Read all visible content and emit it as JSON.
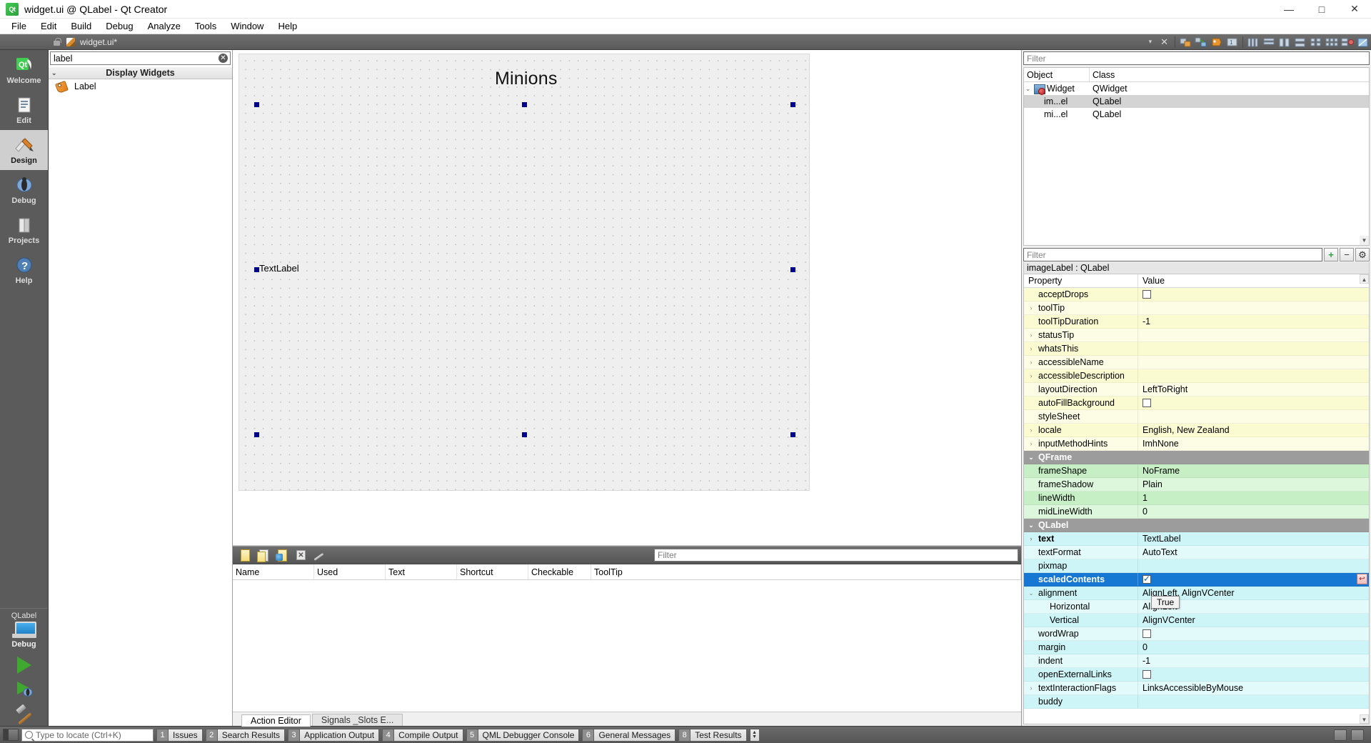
{
  "window": {
    "title": "widget.ui @ QLabel - Qt Creator",
    "app_icon": "qt-logo-icon",
    "minimize": "—",
    "maximize": "□",
    "close": "✕"
  },
  "menubar": [
    {
      "label": "File"
    },
    {
      "label": "Edit"
    },
    {
      "label": "Build"
    },
    {
      "label": "Debug"
    },
    {
      "label": "Analyze"
    },
    {
      "label": "Tools"
    },
    {
      "label": "Window"
    },
    {
      "label": "Help"
    }
  ],
  "toolrow": {
    "file_tab": "widget.ui*",
    "dropdown_arrow": "▾",
    "close_x": "✕"
  },
  "modes": [
    {
      "label": "Welcome",
      "icon": "qt-logo-icon",
      "active": false
    },
    {
      "label": "Edit",
      "icon": "document-lines-icon",
      "active": false
    },
    {
      "label": "Design",
      "icon": "brush-ruler-icon",
      "active": true
    },
    {
      "label": "Debug",
      "icon": "bug-icon",
      "active": false
    },
    {
      "label": "Projects",
      "icon": "books-icon",
      "active": false
    },
    {
      "label": "Help",
      "icon": "question-circle-icon",
      "active": false
    }
  ],
  "kit_selector": {
    "kit_name": "QLabel",
    "build_config": "Debug",
    "monitor_icon": "computer-monitor-icon",
    "expand_arrow": "▸"
  },
  "run_buttons": [
    {
      "name": "run",
      "icon": "green-play-triangle-icon"
    },
    {
      "name": "debug",
      "icon": "play-with-bug-icon"
    },
    {
      "name": "build",
      "icon": "hammer-icon"
    }
  ],
  "widget_box": {
    "filter_value": "label",
    "filter_placeholder": "Filter",
    "clear_icon": "✕",
    "group": {
      "label": "Display Widgets",
      "arrow": "⌄"
    },
    "items": [
      {
        "label": "Label",
        "icon": "label-tag-icon"
      }
    ]
  },
  "canvas": {
    "form_title": "Minions",
    "text_label": "TextLabel",
    "handles": 8
  },
  "action_editor": {
    "toolbar_icons": [
      "new-action-icon",
      "copy-action-icon",
      "edit-action-icon",
      "delete-action-icon",
      "configure-icon"
    ],
    "filter_placeholder": "Filter",
    "columns": [
      "Name",
      "Used",
      "Text",
      "Shortcut",
      "Checkable",
      "ToolTip"
    ],
    "rows": [],
    "tabs": [
      {
        "label": "Action Editor",
        "active": true
      },
      {
        "label": "Signals _Slots E...",
        "active": false
      }
    ]
  },
  "object_inspector": {
    "filter_placeholder": "Filter",
    "columns": [
      "Object",
      "Class"
    ],
    "rows": [
      {
        "object": "Widget",
        "class": "QWidget",
        "depth": 0,
        "expand": "⌄",
        "icon": "widget-icon",
        "selected": false
      },
      {
        "object": "im...el",
        "class": "QLabel",
        "depth": 1,
        "expand": "",
        "icon": "",
        "selected": true
      },
      {
        "object": "mi...el",
        "class": "QLabel",
        "depth": 1,
        "expand": "",
        "icon": "",
        "selected": false
      }
    ]
  },
  "property_editor": {
    "filter_placeholder": "Filter",
    "add_button": "+",
    "remove_button": "−",
    "config_button": "⚙",
    "object_label": "imageLabel : QLabel",
    "columns": [
      "Property",
      "Value"
    ],
    "tooltip": "True",
    "scroll_up": "▲",
    "scroll_down": "▼",
    "reset_icon": "↩",
    "rows": [
      {
        "name": "acceptDrops",
        "value": "",
        "type": "checkbox",
        "checked": false,
        "group": "qwidget",
        "expand": false,
        "indent": 1
      },
      {
        "name": "toolTip",
        "value": "",
        "type": "text",
        "group": "qwidget",
        "expand": true,
        "indent": 0
      },
      {
        "name": "toolTipDuration",
        "value": "-1",
        "type": "text",
        "group": "qwidget",
        "expand": false,
        "indent": 1
      },
      {
        "name": "statusTip",
        "value": "",
        "type": "text",
        "group": "qwidget",
        "expand": true,
        "indent": 0
      },
      {
        "name": "whatsThis",
        "value": "",
        "type": "text",
        "group": "qwidget",
        "expand": true,
        "indent": 0
      },
      {
        "name": "accessibleName",
        "value": "",
        "type": "text",
        "group": "qwidget",
        "expand": true,
        "indent": 0
      },
      {
        "name": "accessibleDescription",
        "value": "",
        "type": "text",
        "group": "qwidget",
        "expand": true,
        "indent": 0
      },
      {
        "name": "layoutDirection",
        "value": "LeftToRight",
        "type": "text",
        "group": "qwidget",
        "expand": false,
        "indent": 1
      },
      {
        "name": "autoFillBackground",
        "value": "",
        "type": "checkbox",
        "checked": false,
        "group": "qwidget",
        "expand": false,
        "indent": 1
      },
      {
        "name": "styleSheet",
        "value": "",
        "type": "text",
        "group": "qwidget",
        "expand": false,
        "indent": 1
      },
      {
        "name": "locale",
        "value": "English, New Zealand",
        "type": "text",
        "group": "qwidget",
        "expand": true,
        "indent": 0
      },
      {
        "name": "inputMethodHints",
        "value": "ImhNone",
        "type": "text",
        "group": "qwidget",
        "expand": true,
        "indent": 0
      },
      {
        "name": "QFrame",
        "value": "",
        "type": "group",
        "group": "header",
        "expand": true,
        "indent": 0
      },
      {
        "name": "frameShape",
        "value": "NoFrame",
        "type": "text",
        "group": "qframe",
        "expand": false,
        "indent": 1
      },
      {
        "name": "frameShadow",
        "value": "Plain",
        "type": "text",
        "group": "qframe",
        "expand": false,
        "indent": 1
      },
      {
        "name": "lineWidth",
        "value": "1",
        "type": "text",
        "group": "qframe",
        "expand": false,
        "indent": 1
      },
      {
        "name": "midLineWidth",
        "value": "0",
        "type": "text",
        "group": "qframe",
        "expand": false,
        "indent": 1
      },
      {
        "name": "QLabel",
        "value": "",
        "type": "group",
        "group": "header",
        "expand": true,
        "indent": 0
      },
      {
        "name": "text",
        "value": "TextLabel",
        "type": "text",
        "group": "qlabel",
        "expand": true,
        "indent": 0,
        "bold": true
      },
      {
        "name": "textFormat",
        "value": "AutoText",
        "type": "text",
        "group": "qlabel",
        "expand": false,
        "indent": 1
      },
      {
        "name": "pixmap",
        "value": "",
        "type": "text",
        "group": "qlabel",
        "expand": false,
        "indent": 1
      },
      {
        "name": "scaledContents",
        "value": "",
        "type": "checkbox",
        "checked": true,
        "group": "qlabel",
        "expand": false,
        "indent": 1,
        "selected": true,
        "reset": true
      },
      {
        "name": "alignment",
        "value": "AlignLeft, AlignVCenter",
        "type": "text",
        "group": "qlabel",
        "expand": true,
        "indent": 0,
        "expanded": true
      },
      {
        "name": "Horizontal",
        "value": "AlignLeft",
        "type": "text",
        "group": "qlabel",
        "expand": false,
        "indent": 2
      },
      {
        "name": "Vertical",
        "value": "AlignVCenter",
        "type": "text",
        "group": "qlabel",
        "expand": false,
        "indent": 2
      },
      {
        "name": "wordWrap",
        "value": "",
        "type": "checkbox",
        "checked": false,
        "group": "qlabel",
        "expand": false,
        "indent": 1
      },
      {
        "name": "margin",
        "value": "0",
        "type": "text",
        "group": "qlabel",
        "expand": false,
        "indent": 1
      },
      {
        "name": "indent",
        "value": "-1",
        "type": "text",
        "group": "qlabel",
        "expand": false,
        "indent": 1
      },
      {
        "name": "openExternalLinks",
        "value": "",
        "type": "checkbox",
        "checked": false,
        "group": "qlabel",
        "expand": false,
        "indent": 1
      },
      {
        "name": "textInteractionFlags",
        "value": "LinksAccessibleByMouse",
        "type": "text",
        "group": "qlabel",
        "expand": true,
        "indent": 0
      },
      {
        "name": "buddy",
        "value": "",
        "type": "text",
        "group": "qlabel",
        "expand": false,
        "indent": 1
      }
    ]
  },
  "statusbar": {
    "sidebar_toggle": "sidebar-toggle-icon",
    "locator_placeholder": "Type to locate (Ctrl+K)",
    "search_icon": "magnifier-icon",
    "outputs": [
      {
        "num": "1",
        "label": "Issues"
      },
      {
        "num": "2",
        "label": "Search Results"
      },
      {
        "num": "3",
        "label": "Application Output"
      },
      {
        "num": "4",
        "label": "Compile Output"
      },
      {
        "num": "5",
        "label": "QML Debugger Console"
      },
      {
        "num": "6",
        "label": "General Messages"
      },
      {
        "num": "8",
        "label": "Test Results"
      }
    ],
    "spin_up": "▲",
    "spin_down": "▼"
  },
  "colors": {
    "accent": "#1678d2",
    "qt_green": "#41cd52",
    "prop_yellow": "#fbfbd2",
    "prop_green": "#c6efc6",
    "prop_cyan": "#cdf5f7",
    "group_gray": "#9c9c9c"
  }
}
